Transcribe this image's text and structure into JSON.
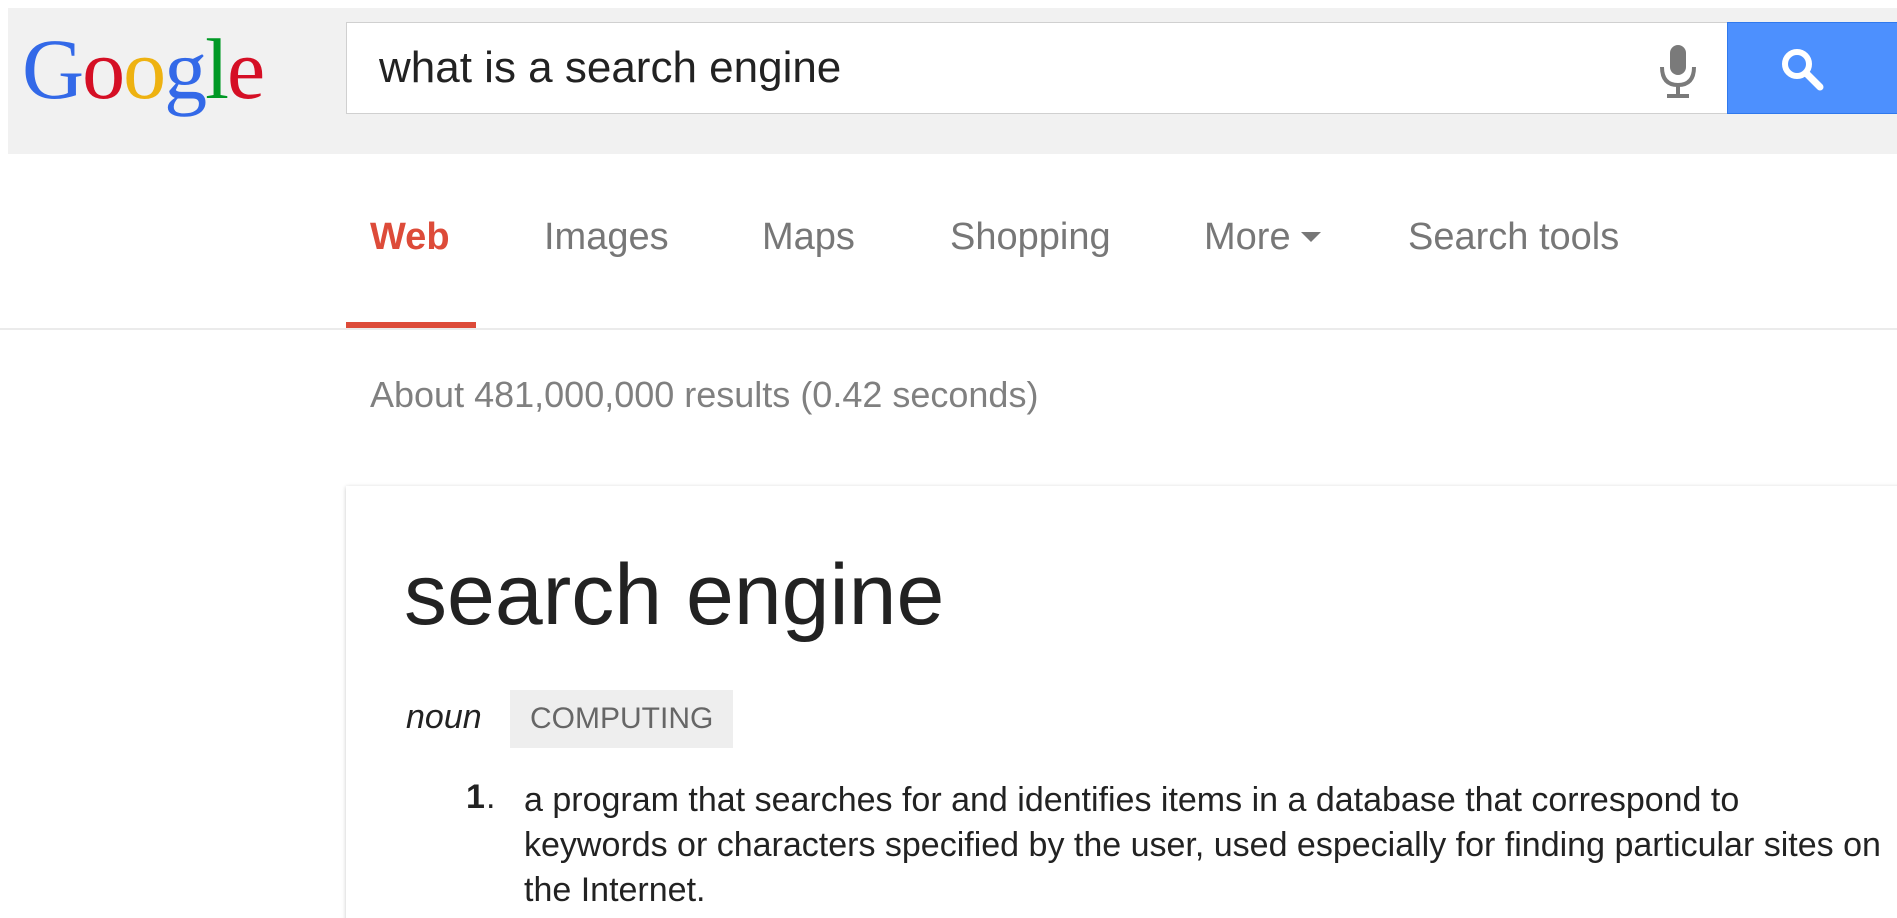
{
  "header": {
    "logo_letters": [
      {
        "ch": "G",
        "color": "#3369e8"
      },
      {
        "ch": "o",
        "color": "#d50f25"
      },
      {
        "ch": "o",
        "color": "#eeb211"
      },
      {
        "ch": "g",
        "color": "#3369e8"
      },
      {
        "ch": "l",
        "color": "#009925"
      },
      {
        "ch": "e",
        "color": "#d50f25"
      }
    ],
    "search": {
      "value": "what is a search engine"
    },
    "mic_icon": "microphone-icon",
    "search_button_icon": "magnifier-icon",
    "search_button_color": "#4d90fe"
  },
  "tabs": {
    "items": [
      {
        "label": "Web",
        "active": true
      },
      {
        "label": "Images",
        "active": false
      },
      {
        "label": "Maps",
        "active": false
      },
      {
        "label": "Shopping",
        "active": false
      },
      {
        "label": "More",
        "active": false,
        "has_dropdown": true
      },
      {
        "label": "Search tools",
        "active": false
      }
    ],
    "active_color": "#dd4b39"
  },
  "results": {
    "stats": "About 481,000,000 results (0.42 seconds)"
  },
  "definition": {
    "term": "search engine",
    "part_of_speech": "noun",
    "domain": "COMPUTING",
    "senses": [
      {
        "number": "1",
        "text": "a program that searches for and identifies items in a database that correspond to keywords or characters specified by the user, used especially for finding particular sites on the Internet."
      }
    ]
  }
}
